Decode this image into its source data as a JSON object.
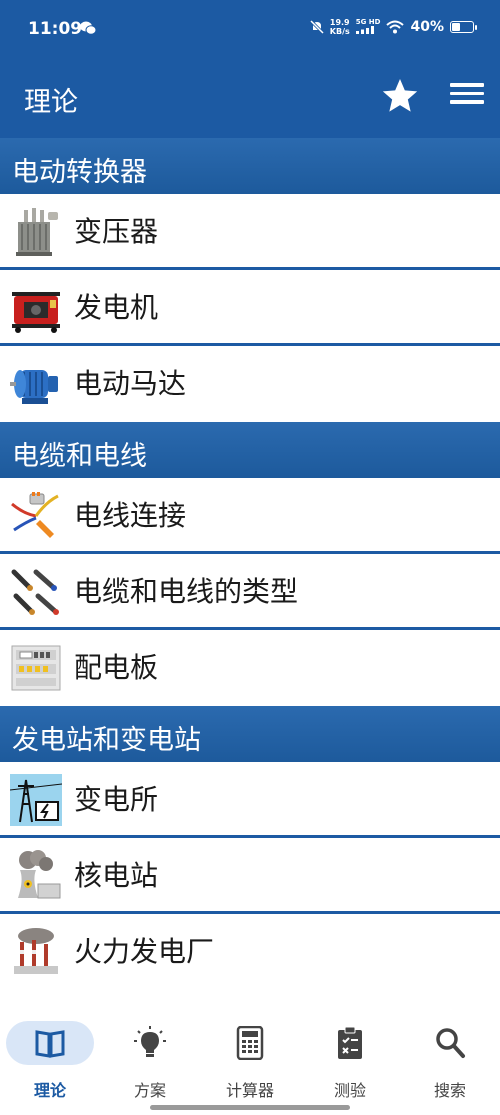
{
  "status_bar": {
    "time": "11:09",
    "speed_value": "19.9",
    "speed_unit": "KB/s",
    "network": "5G HD",
    "battery": "40%",
    "battery_level": 0.4
  },
  "app_bar": {
    "title": "理论",
    "favorite_icon": "star-icon",
    "menu_icon": "hamburger-menu-icon"
  },
  "sections": [
    {
      "title": "电动转换器",
      "items": [
        {
          "label": "变压器",
          "icon": "transformer-icon"
        },
        {
          "label": "发电机",
          "icon": "generator-icon"
        },
        {
          "label": "电动马达",
          "icon": "electric-motor-icon"
        }
      ]
    },
    {
      "title": "电缆和电线",
      "items": [
        {
          "label": "电线连接",
          "icon": "wire-connection-icon"
        },
        {
          "label": "电缆和电线的类型",
          "icon": "cable-types-icon"
        },
        {
          "label": "配电板",
          "icon": "distribution-board-icon"
        }
      ]
    },
    {
      "title": "发电站和变电站",
      "items": [
        {
          "label": "变电所",
          "icon": "substation-icon"
        },
        {
          "label": "核电站",
          "icon": "nuclear-plant-icon"
        },
        {
          "label": "火力发电厂",
          "icon": "thermal-plant-icon"
        }
      ]
    }
  ],
  "bottom_nav": [
    {
      "label": "理论",
      "icon": "book-icon",
      "active": true
    },
    {
      "label": "方案",
      "icon": "lightbulb-icon",
      "active": false
    },
    {
      "label": "计算器",
      "icon": "calculator-icon",
      "active": false
    },
    {
      "label": "测验",
      "icon": "quiz-clipboard-icon",
      "active": false
    },
    {
      "label": "搜索",
      "icon": "search-icon",
      "active": false
    }
  ],
  "colors": {
    "primary": "#1c5aa3",
    "nav_active_bg": "#d9e6f7"
  }
}
